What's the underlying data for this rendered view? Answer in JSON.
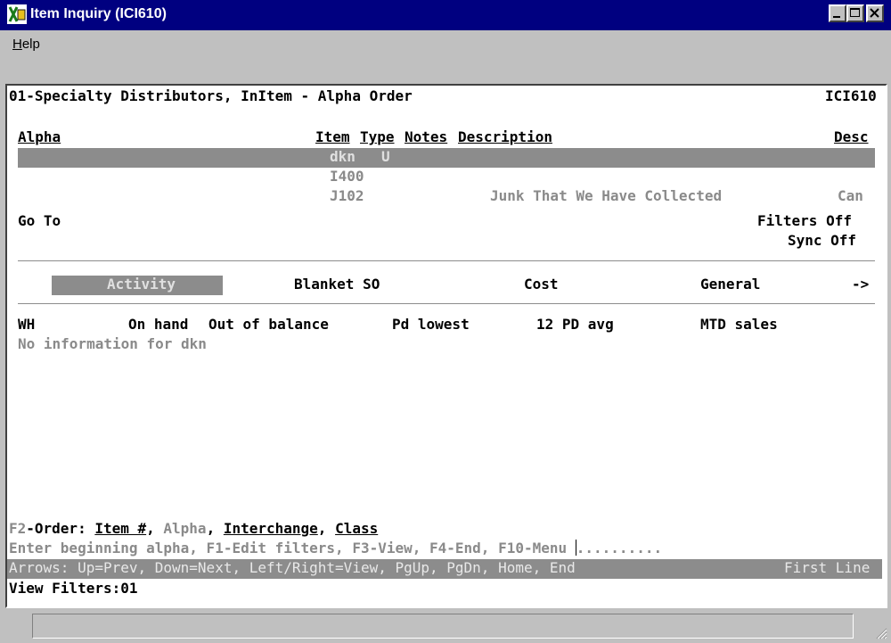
{
  "window": {
    "title": "Item Inquiry (ICI610)",
    "menu": {
      "help_prefix": "H",
      "help_rest": "elp"
    }
  },
  "header": {
    "left": "01-Specialty Distributors, InItem - Alpha Order",
    "right": "ICI610"
  },
  "columns": {
    "alpha": "Alpha",
    "item": "Item",
    "type": "Type",
    "notes": "Notes",
    "description": "Description",
    "desc": "Desc"
  },
  "rows": [
    {
      "item": "dkn",
      "type": "U",
      "description": "",
      "desc": ""
    },
    {
      "item": "I400",
      "type": "",
      "description": "",
      "desc": ""
    },
    {
      "item": "J102",
      "type": "",
      "description": "Junk That We Have Collected",
      "desc": "Can"
    }
  ],
  "goto": {
    "label": "Go To",
    "filters": "Filters Off",
    "sync": "Sync Off"
  },
  "tabs": {
    "items": [
      "Activity",
      "Blanket SO",
      "Cost",
      "General"
    ],
    "more": "->",
    "active": "Activity"
  },
  "activity": {
    "headers": [
      "WH",
      "On hand",
      "Out of balance",
      "Pd lowest",
      "12 PD avg",
      "MTD sales"
    ],
    "empty_message": "No information for dkn"
  },
  "footer": {
    "order_prefix": "F2-Order: ",
    "order_item": "Item #",
    "order_alpha": "Alpha",
    "order_interchange": "Interchange",
    "order_class": "Class",
    "sep": ", ",
    "prompt": "Enter beginning alpha, F1-Edit filters, F3-View, F4-End, F10-Menu ",
    "input_value": "..........",
    "arrows": "Arrows: Up=Prev, Down=Next, Left/Right=View, PgUp, PgDn, Home, End",
    "position": "First Line",
    "view_filters": "View Filters:01"
  }
}
